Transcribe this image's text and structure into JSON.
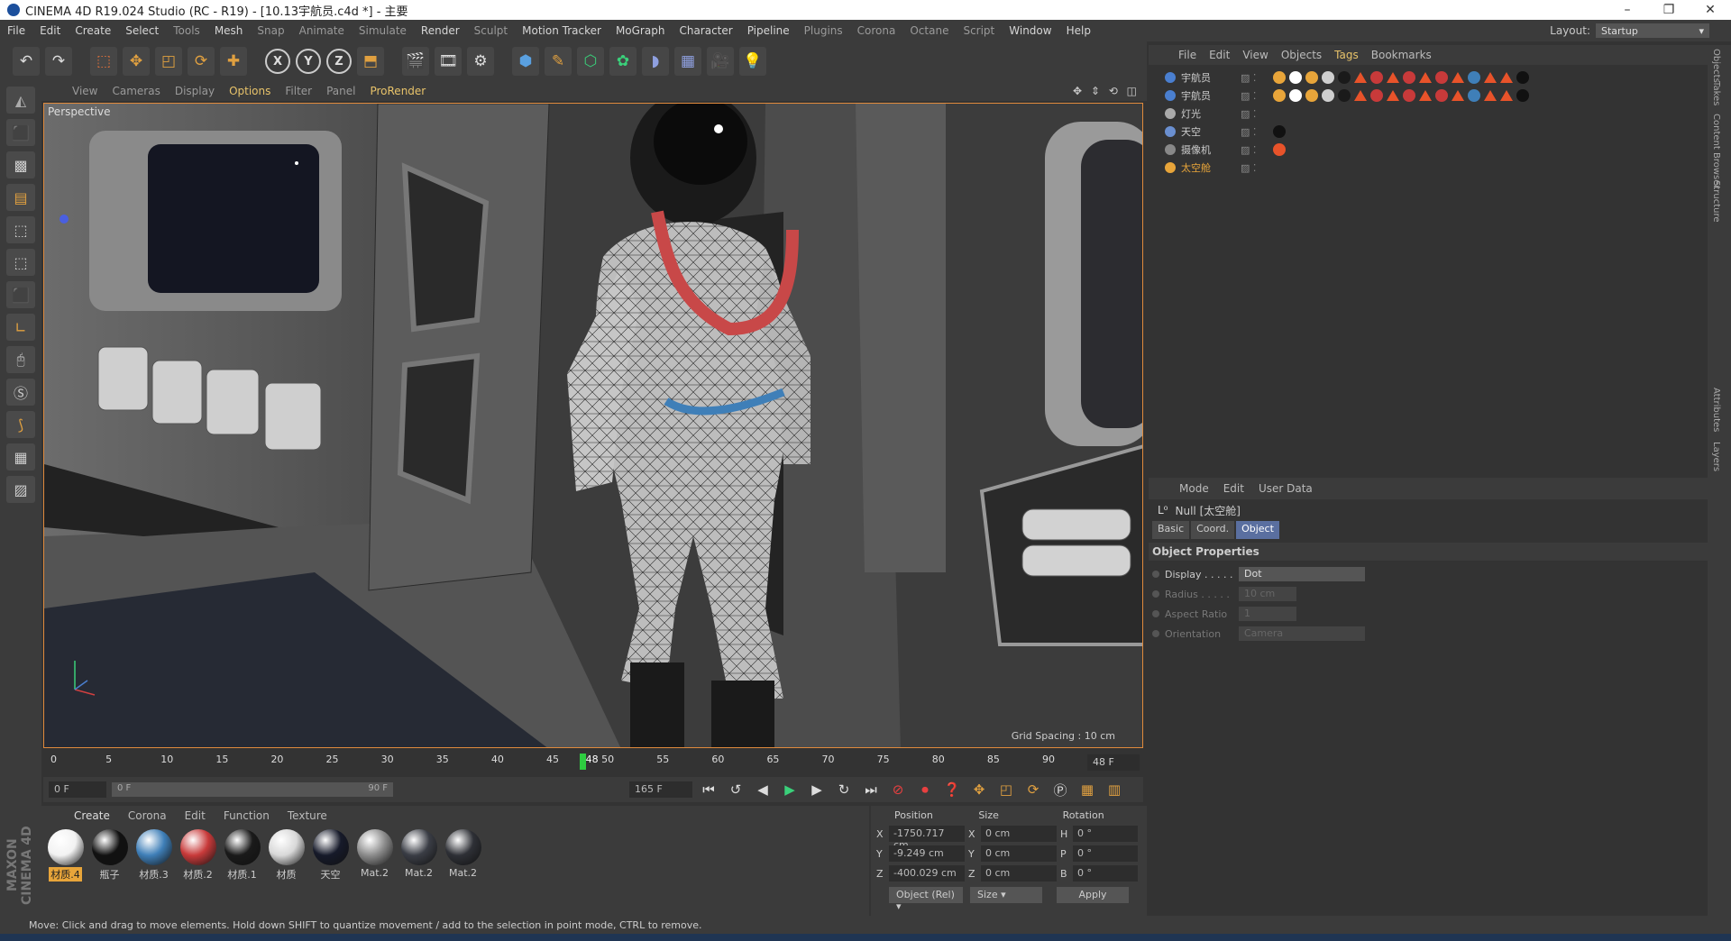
{
  "window": {
    "title": "CINEMA 4D R19.024 Studio (RC - R19) - [10.13宇航员.c4d *] - 主要",
    "controls": [
      "–",
      "❐",
      "✕"
    ]
  },
  "menu": [
    {
      "label": "File",
      "dim": false
    },
    {
      "label": "Edit",
      "dim": false
    },
    {
      "label": "Create",
      "dim": false
    },
    {
      "label": "Select",
      "dim": false
    },
    {
      "label": "Tools",
      "dim": true
    },
    {
      "label": "Mesh",
      "dim": false
    },
    {
      "label": "Snap",
      "dim": true
    },
    {
      "label": "Animate",
      "dim": true
    },
    {
      "label": "Simulate",
      "dim": true
    },
    {
      "label": "Render",
      "dim": false
    },
    {
      "label": "Sculpt",
      "dim": true
    },
    {
      "label": "Motion Tracker",
      "dim": false
    },
    {
      "label": "MoGraph",
      "dim": false
    },
    {
      "label": "Character",
      "dim": false
    },
    {
      "label": "Pipeline",
      "dim": false
    },
    {
      "label": "Plugins",
      "dim": true
    },
    {
      "label": "Corona",
      "dim": true
    },
    {
      "label": "Octane",
      "dim": true
    },
    {
      "label": "Script",
      "dim": true
    },
    {
      "label": "Window",
      "dim": false
    },
    {
      "label": "Help",
      "dim": false
    }
  ],
  "layout": {
    "label": "Layout:",
    "value": "Startup"
  },
  "toolbar": {
    "x": "X",
    "y": "Y",
    "z": "Z"
  },
  "viewport_menu": [
    {
      "label": "View",
      "hl": false
    },
    {
      "label": "Cameras",
      "hl": false
    },
    {
      "label": "Display",
      "hl": false
    },
    {
      "label": "Options",
      "hl": true
    },
    {
      "label": "Filter",
      "hl": false
    },
    {
      "label": "Panel",
      "hl": false
    },
    {
      "label": "ProRender",
      "hl": true
    }
  ],
  "viewport": {
    "label": "Perspective",
    "grid_spacing": "Grid Spacing : 10 cm"
  },
  "timeline": {
    "ticks": [
      "0",
      "5",
      "10",
      "15",
      "20",
      "25",
      "30",
      "35",
      "40",
      "45",
      "50",
      "55",
      "60",
      "65",
      "70",
      "75",
      "80",
      "85",
      "90"
    ],
    "current_frame": "48",
    "end_display": "48 F"
  },
  "transport": {
    "start": "0 F",
    "range_start": "0 F",
    "range_end": "90 F",
    "end": "165 F"
  },
  "material_menu": [
    "Create",
    "Corona",
    "Edit",
    "Function",
    "Texture"
  ],
  "materials": [
    {
      "name": "材质.4",
      "color": "#f2f2f2",
      "selected": true
    },
    {
      "name": "瓶子",
      "color": "#111111",
      "selected": false
    },
    {
      "name": "材质.3",
      "color": "#3f7fb8",
      "selected": false
    },
    {
      "name": "材质.2",
      "color": "#c83a3a",
      "selected": false
    },
    {
      "name": "材质.1",
      "color": "#1a1a1a",
      "selected": false
    },
    {
      "name": "材质",
      "color": "#d8d8d8",
      "selected": false
    },
    {
      "name": "天空",
      "color": "#161a2a",
      "selected": false
    },
    {
      "name": "Mat.2",
      "color": "#8c8c8c",
      "selected": false
    },
    {
      "name": "Mat.2",
      "color": "#3a3d45",
      "selected": false
    },
    {
      "name": "Mat.2",
      "color": "#2e3036",
      "selected": false
    }
  ],
  "coords": {
    "headers": [
      "Position",
      "Size",
      "Rotation"
    ],
    "rows": [
      {
        "axis": "X",
        "pos": "-1750.717 cm",
        "size_axis": "X",
        "size": "0 cm",
        "rot_axis": "H",
        "rot": "0 °"
      },
      {
        "axis": "Y",
        "pos": "-9.249 cm",
        "size_axis": "Y",
        "size": "0 cm",
        "rot_axis": "P",
        "rot": "0 °"
      },
      {
        "axis": "Z",
        "pos": "-400.029 cm",
        "size_axis": "Z",
        "size": "0 cm",
        "rot_axis": "B",
        "rot": "0 °"
      }
    ],
    "mode": "Object (Rel)",
    "size_mode": "Size",
    "apply": "Apply"
  },
  "status": "Move: Click and drag to move elements. Hold down SHIFT to quantize movement / add to the selection in point mode, CTRL to remove.",
  "object_menu": [
    {
      "label": "File",
      "hl": false
    },
    {
      "label": "Edit",
      "hl": false
    },
    {
      "label": "View",
      "hl": false
    },
    {
      "label": "Objects",
      "hl": false
    },
    {
      "label": "Tags",
      "hl": true
    },
    {
      "label": "Bookmarks",
      "hl": false
    }
  ],
  "objects": [
    {
      "name": "宇航员",
      "selected": false,
      "icon": "#4a7fd0"
    },
    {
      "name": "宇航员",
      "selected": false,
      "icon": "#4a7fd0"
    },
    {
      "name": "灯光",
      "selected": false,
      "icon": "#aaaaaa"
    },
    {
      "name": "天空",
      "selected": false,
      "icon": "#6a8fd0"
    },
    {
      "name": "摄像机",
      "selected": false,
      "icon": "#888888"
    },
    {
      "name": "太空舱",
      "selected": true,
      "icon": "#e8a53a"
    }
  ],
  "attr_menu": [
    "Mode",
    "Edit",
    "User Data"
  ],
  "attr": {
    "title": "Null [太空舱]",
    "tabs": [
      {
        "label": "Basic",
        "active": false
      },
      {
        "label": "Coord.",
        "active": false
      },
      {
        "label": "Object",
        "active": true
      }
    ],
    "section": "Object Properties",
    "props": [
      {
        "label": "Display . . . . .",
        "value": "Dot",
        "disabled": false
      },
      {
        "label": "Radius . . . . .",
        "value": "10 cm",
        "disabled": true
      },
      {
        "label": "Aspect Ratio",
        "value": "1",
        "disabled": true
      },
      {
        "label": "Orientation",
        "value": "Camera",
        "disabled": true
      }
    ]
  },
  "side_tabs": [
    "Objects",
    "Takes",
    "Content Browser",
    "Structure",
    "Attributes",
    "Layers"
  ]
}
